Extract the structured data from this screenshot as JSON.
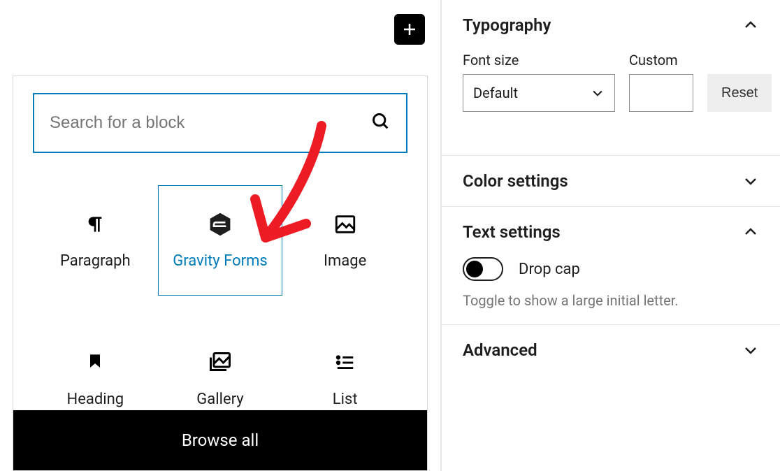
{
  "inserter": {
    "search_placeholder": "Search for a block",
    "blocks": [
      {
        "label": "Paragraph"
      },
      {
        "label": "Gravity Forms"
      },
      {
        "label": "Image"
      },
      {
        "label": "Heading"
      },
      {
        "label": "Gallery"
      },
      {
        "label": "List"
      }
    ],
    "browse_all_label": "Browse all"
  },
  "sidebar": {
    "typography": {
      "title": "Typography",
      "font_size_label": "Font size",
      "font_size_value": "Default",
      "custom_label": "Custom",
      "custom_value": "",
      "reset_label": "Reset"
    },
    "color_settings": {
      "title": "Color settings"
    },
    "text_settings": {
      "title": "Text settings",
      "dropcap_label": "Drop cap",
      "dropcap_on": false,
      "help": "Toggle to show a large initial letter."
    },
    "advanced": {
      "title": "Advanced"
    }
  }
}
